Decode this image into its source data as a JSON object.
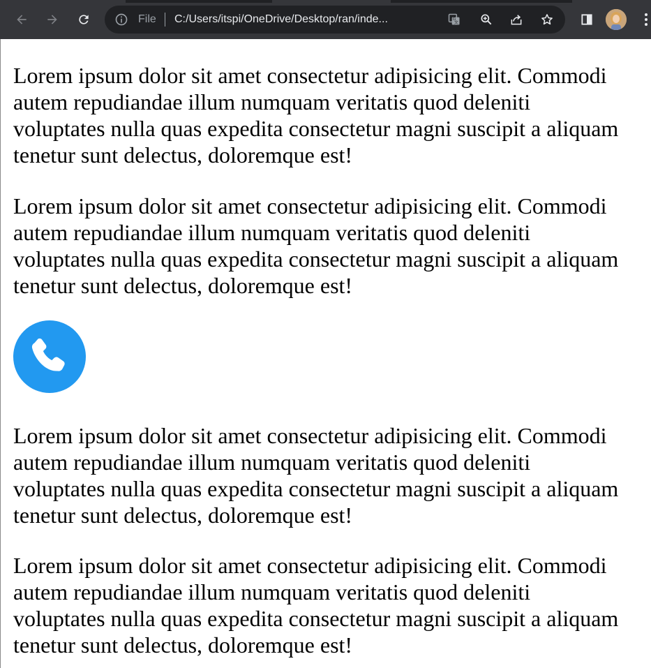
{
  "browser": {
    "omnibox": {
      "scheme_label": "File",
      "url": "C:/Users/itspi/OneDrive/Desktop/ran/inde..."
    },
    "icons": [
      "back-arrow-icon",
      "forward-arrow-icon",
      "reload-icon",
      "info-icon",
      "translate-icon",
      "zoom-icon",
      "share-icon",
      "bookmark-star-icon",
      "side-panel-icon",
      "profile-avatar",
      "kebab-menu-icon"
    ]
  },
  "page": {
    "paragraphs": [
      "Lorem ipsum dolor sit amet consectetur adipisicing elit. Commodi\nautem repudiandae illum numquam veritatis quod deleniti\nvoluptates nulla quas expedita consectetur magni suscipit a aliquam\ntenetur sunt delectus, doloremque est!",
      "Lorem ipsum dolor sit amet consectetur adipisicing elit. Commodi\nautem repudiandae illum numquam veritatis quod deleniti\nvoluptates nulla quas expedita consectetur magni suscipit a aliquam\ntenetur sunt delectus, doloremque est!",
      "Lorem ipsum dolor sit amet consectetur adipisicing elit. Commodi\nautem repudiandae illum numquam veritatis quod deleniti\nvoluptates nulla quas expedita consectetur magni suscipit a aliquam\ntenetur sunt delectus, doloremque est!",
      "Lorem ipsum dolor sit amet consectetur adipisicing elit. Commodi\nautem repudiandae illum numquam veritatis quod deleniti\nvoluptates nulla quas expedita consectetur magni suscipit a aliquam\ntenetur sunt delectus, doloremque est!"
    ],
    "phone_icon": "phone-icon"
  },
  "colors": {
    "toolbar_bg": "#35363a",
    "omnibox_bg": "#202124",
    "phone_button": "#2299f0",
    "text": "#000000"
  }
}
